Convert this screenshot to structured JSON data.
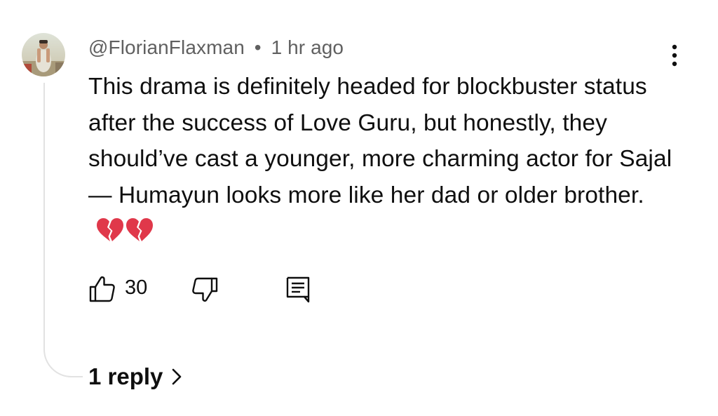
{
  "comment": {
    "author": "@FlorianFlaxman",
    "separator": "•",
    "timestamp": "1 hr ago",
    "text": "This drama is definitely headed for blockbuster status after the success of Love Guru, but honestly, they should’ve cast a younger, more charming actor for Sajal — Humayun looks more like her dad or older brother.",
    "emojis": [
      "broken-heart-icon",
      "broken-heart-icon"
    ],
    "like_count": "30"
  },
  "replies": {
    "label": "1 reply"
  },
  "icons": {
    "like": "thumbs-up-icon",
    "dislike": "thumbs-down-icon",
    "reply": "comment-icon",
    "more": "more-vert-icon",
    "expand": "chevron-right-icon"
  },
  "colors": {
    "text": "#0f0f0f",
    "meta": "#606060",
    "thread_line": "#e2e2e2",
    "broken_heart": "#e0384a"
  }
}
